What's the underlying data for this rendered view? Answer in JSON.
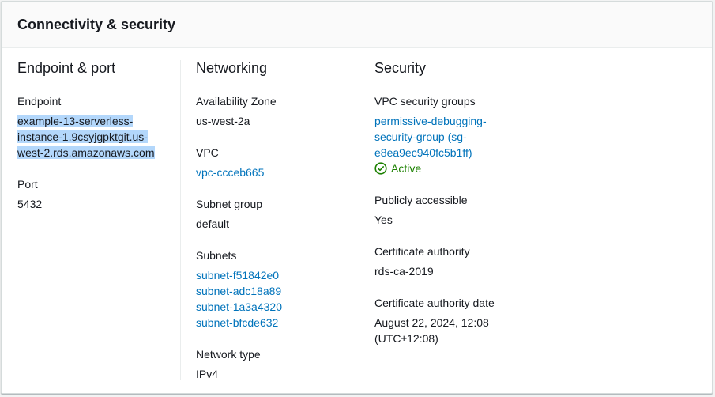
{
  "panel": {
    "title": "Connectivity & security"
  },
  "endpoint_port": {
    "heading": "Endpoint & port",
    "endpoint_label": "Endpoint",
    "endpoint_lines": [
      "example-13-serverless-",
      "instance-1.9csyjgpktgit.us-",
      "west-2.rds.amazonaws.com"
    ],
    "port_label": "Port",
    "port_value": "5432"
  },
  "networking": {
    "heading": "Networking",
    "az_label": "Availability Zone",
    "az_value": "us-west-2a",
    "vpc_label": "VPC",
    "vpc_value": "vpc-ccceb665",
    "subnet_group_label": "Subnet group",
    "subnet_group_value": "default",
    "subnets_label": "Subnets",
    "subnets": [
      "subnet-f51842e0",
      "subnet-adc18a89",
      "subnet-1a3a4320",
      "subnet-bfcde632"
    ],
    "network_type_label": "Network type",
    "network_type_value": "IPv4"
  },
  "security": {
    "heading": "Security",
    "sg_label": "VPC security groups",
    "sg_lines": [
      "permissive-debugging-",
      "security-group (sg-",
      "e8ea9ec940fc5b1ff)"
    ],
    "sg_status": "Active",
    "public_label": "Publicly accessible",
    "public_value": "Yes",
    "ca_label": "Certificate authority",
    "ca_value": "rds-ca-2019",
    "ca_date_label": "Certificate authority date",
    "ca_date_lines": [
      "August 22, 2024, 12:08",
      "(UTC±12:08)"
    ]
  },
  "colors": {
    "link": "#0073bb",
    "success": "#1d8102",
    "selection": "#b3d7fb"
  },
  "icons": {
    "status": "check-circle-icon"
  }
}
